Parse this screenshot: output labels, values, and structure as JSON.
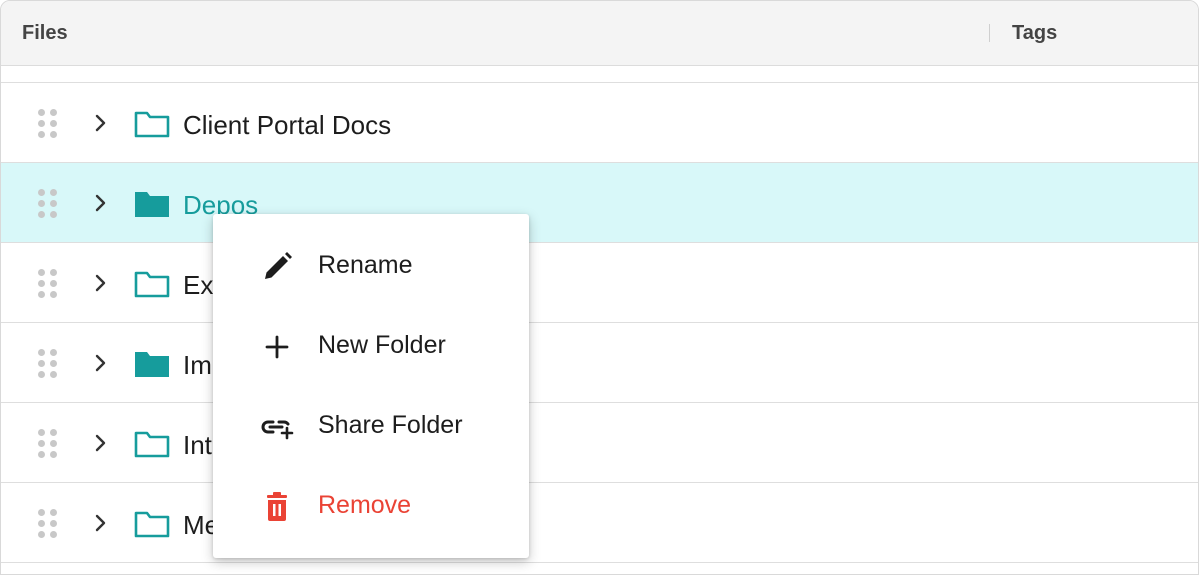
{
  "header": {
    "files_label": "Files",
    "tags_label": "Tags"
  },
  "rows": [
    {
      "name": "Client Portal Docs",
      "selected": false,
      "folder": "outline"
    },
    {
      "name": "Depos",
      "selected": true,
      "folder": "filled"
    },
    {
      "name": "Ex",
      "selected": false,
      "folder": "outline"
    },
    {
      "name": "Im",
      "selected": false,
      "folder": "filled"
    },
    {
      "name": "Int",
      "selected": false,
      "folder": "outline"
    },
    {
      "name": "Me",
      "selected": false,
      "folder": "outline"
    }
  ],
  "context_menu": {
    "items": [
      {
        "label": "Rename",
        "icon": "pencil-icon"
      },
      {
        "label": "New Folder",
        "icon": "plus-icon"
      },
      {
        "label": "Share Folder",
        "icon": "link-add-icon"
      },
      {
        "label": "Remove",
        "icon": "trash-icon"
      }
    ]
  },
  "colors": {
    "accent": "#169c9c",
    "selected_row_bg": "#d8f8f9",
    "danger": "#ea4335",
    "header_bg": "#f4f4f4"
  }
}
